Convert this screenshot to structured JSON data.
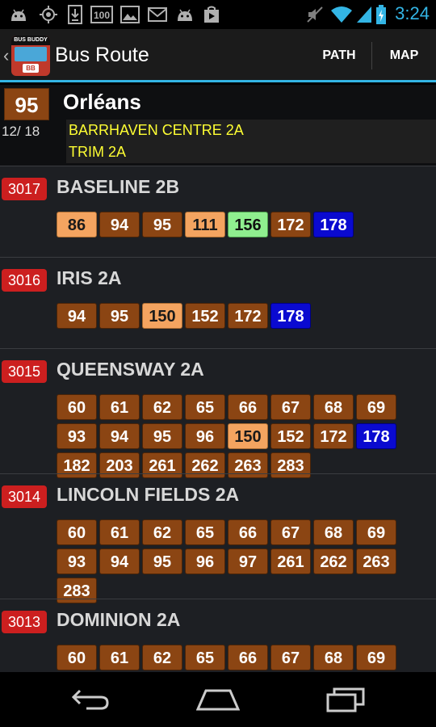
{
  "status_bar": {
    "time": "3:24",
    "icons": [
      "android-icon",
      "gps-icon",
      "download-icon",
      "battery-100-icon",
      "image-icon",
      "gmail-icon",
      "android-icon",
      "play-store-icon",
      "mute-icon",
      "wifi-icon",
      "signal-icon",
      "battery-charging-icon"
    ]
  },
  "action_bar": {
    "title": "Bus Route",
    "logo_top_text": "BUS BUDDY",
    "logo_badge": "BB",
    "path_label": "PATH",
    "map_label": "MAP"
  },
  "route": {
    "number": "95",
    "destination": "Orléans",
    "count": "12/ 18",
    "via": [
      "BARRHAVEN CENTRE 2A",
      "TRIM 2A"
    ]
  },
  "colors": {
    "brown": "#8b4513",
    "peach": "#f4a460",
    "green": "#8fee8f",
    "blue": "#0a0ad0",
    "stop_code": "#cc1f1f",
    "via_text": "#ffff33",
    "accent": "#33b5e5"
  },
  "stops": [
    {
      "code": "3017",
      "name": "BASELINE 2B",
      "routes": [
        {
          "n": "86",
          "c": "peach"
        },
        {
          "n": "94",
          "c": "brown"
        },
        {
          "n": "95",
          "c": "brown"
        },
        {
          "n": "111",
          "c": "peach"
        },
        {
          "n": "156",
          "c": "green"
        },
        {
          "n": "172",
          "c": "brown"
        },
        {
          "n": "178",
          "c": "blue"
        }
      ]
    },
    {
      "code": "3016",
      "name": "IRIS 2A",
      "routes": [
        {
          "n": "94",
          "c": "brown"
        },
        {
          "n": "95",
          "c": "brown"
        },
        {
          "n": "150",
          "c": "peach"
        },
        {
          "n": "152",
          "c": "brown"
        },
        {
          "n": "172",
          "c": "brown"
        },
        {
          "n": "178",
          "c": "blue"
        }
      ]
    },
    {
      "code": "3015",
      "name": "QUEENSWAY 2A",
      "routes": [
        {
          "n": "60",
          "c": "brown"
        },
        {
          "n": "61",
          "c": "brown"
        },
        {
          "n": "62",
          "c": "brown"
        },
        {
          "n": "65",
          "c": "brown"
        },
        {
          "n": "66",
          "c": "brown"
        },
        {
          "n": "67",
          "c": "brown"
        },
        {
          "n": "68",
          "c": "brown"
        },
        {
          "n": "69",
          "c": "brown"
        },
        {
          "n": "93",
          "c": "brown"
        },
        {
          "n": "94",
          "c": "brown"
        },
        {
          "n": "95",
          "c": "brown"
        },
        {
          "n": "96",
          "c": "brown"
        },
        {
          "n": "150",
          "c": "peach"
        },
        {
          "n": "152",
          "c": "brown"
        },
        {
          "n": "172",
          "c": "brown"
        },
        {
          "n": "178",
          "c": "blue"
        },
        {
          "n": "182",
          "c": "brown"
        },
        {
          "n": "203",
          "c": "brown"
        },
        {
          "n": "261",
          "c": "brown"
        },
        {
          "n": "262",
          "c": "brown"
        },
        {
          "n": "263",
          "c": "brown"
        },
        {
          "n": "283",
          "c": "brown"
        }
      ]
    },
    {
      "code": "3014",
      "name": "LINCOLN FIELDS 2A",
      "routes": [
        {
          "n": "60",
          "c": "brown"
        },
        {
          "n": "61",
          "c": "brown"
        },
        {
          "n": "62",
          "c": "brown"
        },
        {
          "n": "65",
          "c": "brown"
        },
        {
          "n": "66",
          "c": "brown"
        },
        {
          "n": "67",
          "c": "brown"
        },
        {
          "n": "68",
          "c": "brown"
        },
        {
          "n": "69",
          "c": "brown"
        },
        {
          "n": "93",
          "c": "brown"
        },
        {
          "n": "94",
          "c": "brown"
        },
        {
          "n": "95",
          "c": "brown"
        },
        {
          "n": "96",
          "c": "brown"
        },
        {
          "n": "97",
          "c": "brown"
        },
        {
          "n": "261",
          "c": "brown"
        },
        {
          "n": "262",
          "c": "brown"
        },
        {
          "n": "263",
          "c": "brown"
        },
        {
          "n": "283",
          "c": "brown"
        }
      ]
    },
    {
      "code": "3013",
      "name": "DOMINION 2A",
      "routes": [
        {
          "n": "60",
          "c": "brown"
        },
        {
          "n": "61",
          "c": "brown"
        },
        {
          "n": "62",
          "c": "brown"
        },
        {
          "n": "65",
          "c": "brown"
        },
        {
          "n": "66",
          "c": "brown"
        },
        {
          "n": "67",
          "c": "brown"
        },
        {
          "n": "68",
          "c": "brown"
        },
        {
          "n": "69",
          "c": "brown"
        }
      ]
    }
  ],
  "nav_bar": {
    "buttons": [
      "back-icon",
      "home-icon",
      "recent-apps-icon"
    ]
  }
}
